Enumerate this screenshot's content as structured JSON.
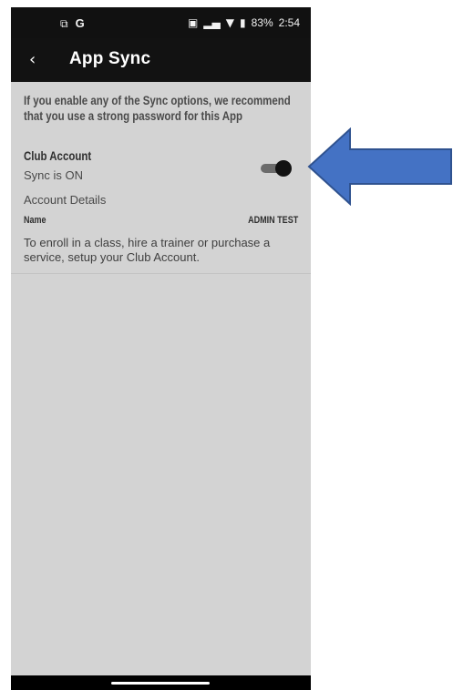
{
  "status_bar": {
    "left_icons": [
      "cast-icon",
      "g-icon"
    ],
    "g_label": "G",
    "battery": "83%",
    "time": "2:54"
  },
  "app_bar": {
    "back_icon": "chevron-left-icon",
    "title": "App Sync"
  },
  "sync": {
    "notice": "If you enable any of the Sync options, we recommend that you use a strong password for this App",
    "club_account_label": "Club Account",
    "status": "Sync is ON",
    "toggle_on": true,
    "account_details_label": "Account Details",
    "name_label": "Name",
    "name_value": "ADMIN TEST",
    "enroll_text": "To enroll in a class, hire a trainer or purchase a service, setup your Club Account."
  },
  "annotation": {
    "arrow_color": "#4472c4",
    "arrow_direction": "left"
  },
  "colors": {
    "background": "#d3d3d3",
    "appbar": "#121212",
    "toggle_thumb": "#121212"
  }
}
